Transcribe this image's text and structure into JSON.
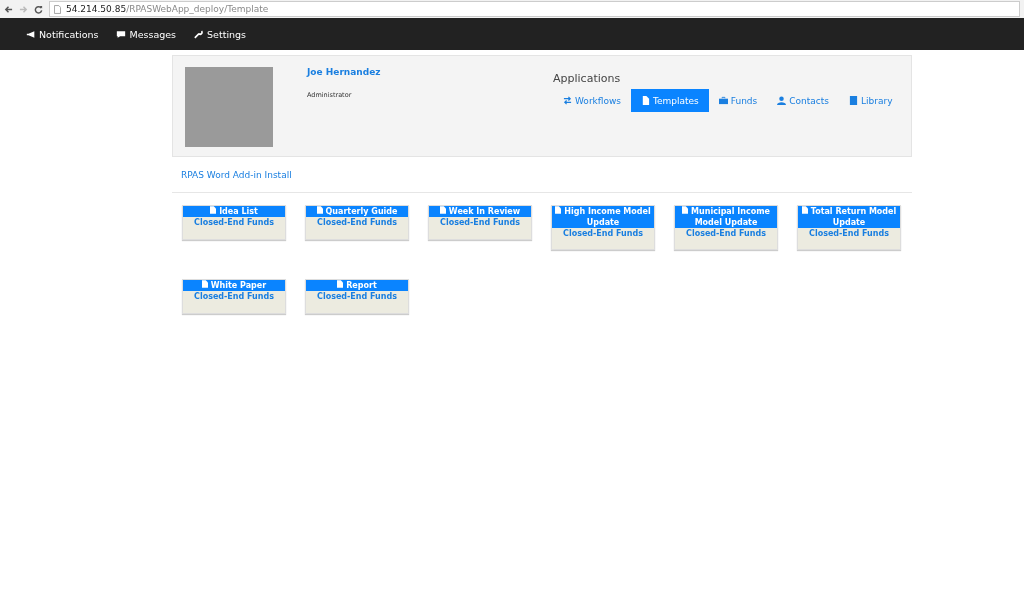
{
  "browser": {
    "address_host": "54.214.50.85",
    "address_path": "/RPASWebApp_deploy/Template"
  },
  "navbar": {
    "items": [
      {
        "label": "Notifications"
      },
      {
        "label": "Messages"
      },
      {
        "label": "Settings"
      }
    ]
  },
  "profile": {
    "name": "Joe Hernandez",
    "role": "Administrator"
  },
  "applications": {
    "title": "Applications",
    "tabs": [
      {
        "label": "Workflows",
        "selected": false
      },
      {
        "label": "Templates",
        "selected": true
      },
      {
        "label": "Funds",
        "selected": false
      },
      {
        "label": "Contacts",
        "selected": false
      },
      {
        "label": "Library",
        "selected": false
      }
    ]
  },
  "install_link": "RPAS Word Add-in Install",
  "templates": [
    {
      "title": "Idea List",
      "category": "Closed-End Funds"
    },
    {
      "title": "Quarterly Guide",
      "category": "Closed-End Funds"
    },
    {
      "title": "Week In Review",
      "category": "Closed-End Funds"
    },
    {
      "title": "High Income Model Update",
      "category": "Closed-End Funds"
    },
    {
      "title": "Municipal Income Model Update",
      "category": "Closed-End Funds"
    },
    {
      "title": "Total Return Model Update",
      "category": "Closed-End Funds"
    },
    {
      "title": "White Paper",
      "category": "Closed-End Funds"
    },
    {
      "title": "Report",
      "category": "Closed-End Funds"
    }
  ]
}
